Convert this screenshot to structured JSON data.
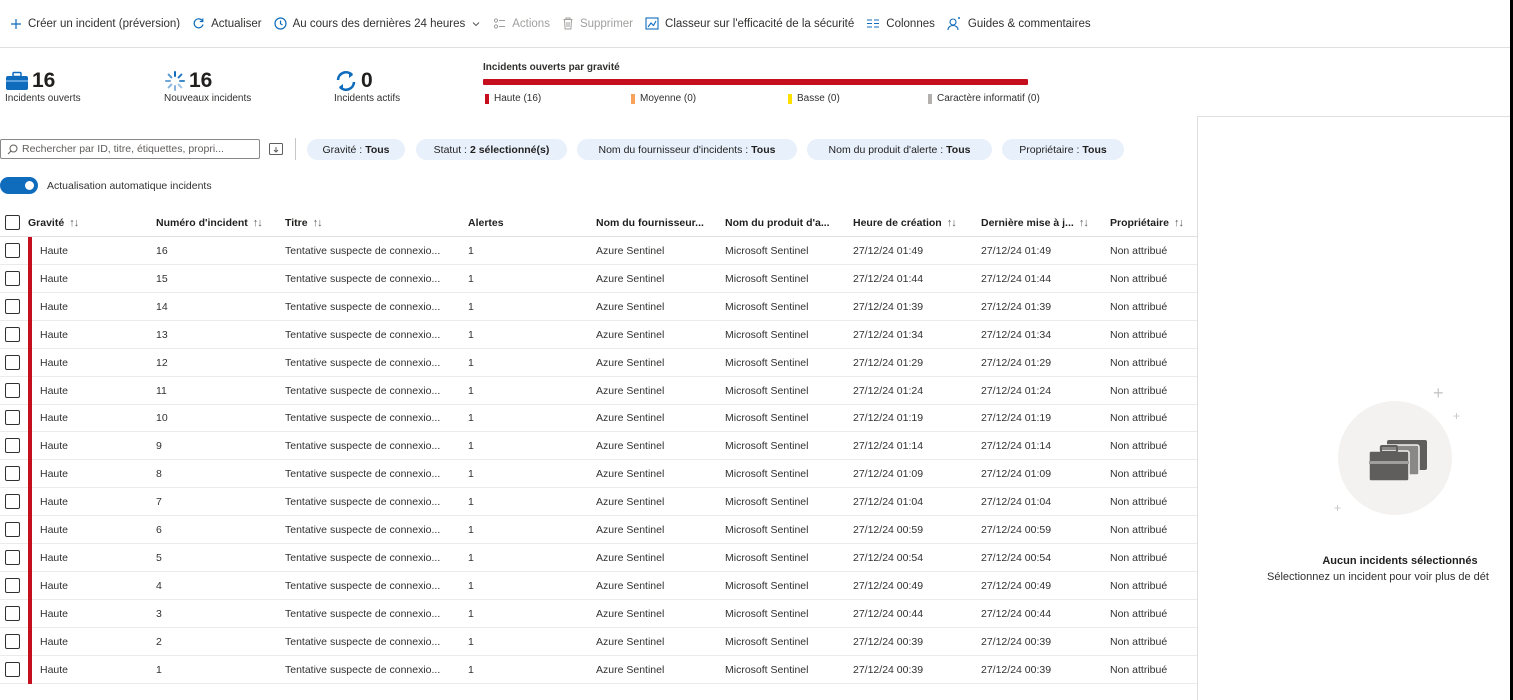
{
  "toolbar": {
    "create": "Créer un incident (préversion)",
    "refresh": "Actualiser",
    "timerange": "Au cours des dernières 24 heures",
    "actions": "Actions",
    "delete": "Supprimer",
    "workbook": "Classeur sur l'efficacité de la sécurité",
    "columns": "Colonnes",
    "guides": "Guides & commentaires"
  },
  "stats": {
    "open": {
      "value": "16",
      "label": "Incidents ouverts"
    },
    "new": {
      "value": "16",
      "label": "Nouveaux incidents"
    },
    "active": {
      "value": "0",
      "label": "Incidents actifs"
    }
  },
  "severity": {
    "title": "Incidents ouverts par gravité",
    "legend": [
      {
        "label": "Haute (16)",
        "color": "#c50f1f"
      },
      {
        "label": "Moyenne (0)",
        "color": "#f7a35c"
      },
      {
        "label": "Basse (0)",
        "color": "#fce100"
      },
      {
        "label": "Caractère informatif (0)",
        "color": "#b3b0ad"
      }
    ]
  },
  "filters": {
    "search_placeholder": "Rechercher par ID, titre, étiquettes, propri...",
    "pills": [
      {
        "name": "Gravité :",
        "value": "Tous"
      },
      {
        "name": "Statut :",
        "value": "2 sélectionné(s)"
      },
      {
        "name": "Nom du fournisseur d'incidents :",
        "value": "Tous"
      },
      {
        "name": "Nom du produit d'alerte :",
        "value": "Tous"
      },
      {
        "name": "Propriétaire :",
        "value": "Tous"
      }
    ],
    "auto_refresh": "Actualisation automatique incidents"
  },
  "table": {
    "columns": [
      "Gravité",
      "Numéro d'incident",
      "Titre",
      "Alertes",
      "Nom du fournisseur...",
      "Nom du produit d'a...",
      "Heure de création",
      "Dernière mise à j...",
      "Propriétaire"
    ],
    "rows": [
      [
        "Haute",
        "16",
        "Tentative suspecte de connexio...",
        "1",
        "Azure Sentinel",
        "Microsoft Sentinel",
        "27/12/24 01:49",
        "27/12/24 01:49",
        "Non attribué"
      ],
      [
        "Haute",
        "15",
        "Tentative suspecte de connexio...",
        "1",
        "Azure Sentinel",
        "Microsoft Sentinel",
        "27/12/24 01:44",
        "27/12/24 01:44",
        "Non attribué"
      ],
      [
        "Haute",
        "14",
        "Tentative suspecte de connexio...",
        "1",
        "Azure Sentinel",
        "Microsoft Sentinel",
        "27/12/24 01:39",
        "27/12/24 01:39",
        "Non attribué"
      ],
      [
        "Haute",
        "13",
        "Tentative suspecte de connexio...",
        "1",
        "Azure Sentinel",
        "Microsoft Sentinel",
        "27/12/24 01:34",
        "27/12/24 01:34",
        "Non attribué"
      ],
      [
        "Haute",
        "12",
        "Tentative suspecte de connexio...",
        "1",
        "Azure Sentinel",
        "Microsoft Sentinel",
        "27/12/24 01:29",
        "27/12/24 01:29",
        "Non attribué"
      ],
      [
        "Haute",
        "11",
        "Tentative suspecte de connexio...",
        "1",
        "Azure Sentinel",
        "Microsoft Sentinel",
        "27/12/24 01:24",
        "27/12/24 01:24",
        "Non attribué"
      ],
      [
        "Haute",
        "10",
        "Tentative suspecte de connexio...",
        "1",
        "Azure Sentinel",
        "Microsoft Sentinel",
        "27/12/24 01:19",
        "27/12/24 01:19",
        "Non attribué"
      ],
      [
        "Haute",
        "9",
        "Tentative suspecte de connexio...",
        "1",
        "Azure Sentinel",
        "Microsoft Sentinel",
        "27/12/24 01:14",
        "27/12/24 01:14",
        "Non attribué"
      ],
      [
        "Haute",
        "8",
        "Tentative suspecte de connexio...",
        "1",
        "Azure Sentinel",
        "Microsoft Sentinel",
        "27/12/24 01:09",
        "27/12/24 01:09",
        "Non attribué"
      ],
      [
        "Haute",
        "7",
        "Tentative suspecte de connexio...",
        "1",
        "Azure Sentinel",
        "Microsoft Sentinel",
        "27/12/24 01:04",
        "27/12/24 01:04",
        "Non attribué"
      ],
      [
        "Haute",
        "6",
        "Tentative suspecte de connexio...",
        "1",
        "Azure Sentinel",
        "Microsoft Sentinel",
        "27/12/24 00:59",
        "27/12/24 00:59",
        "Non attribué"
      ],
      [
        "Haute",
        "5",
        "Tentative suspecte de connexio...",
        "1",
        "Azure Sentinel",
        "Microsoft Sentinel",
        "27/12/24 00:54",
        "27/12/24 00:54",
        "Non attribué"
      ],
      [
        "Haute",
        "4",
        "Tentative suspecte de connexio...",
        "1",
        "Azure Sentinel",
        "Microsoft Sentinel",
        "27/12/24 00:49",
        "27/12/24 00:49",
        "Non attribué"
      ],
      [
        "Haute",
        "3",
        "Tentative suspecte de connexio...",
        "1",
        "Azure Sentinel",
        "Microsoft Sentinel",
        "27/12/24 00:44",
        "27/12/24 00:44",
        "Non attribué"
      ],
      [
        "Haute",
        "2",
        "Tentative suspecte de connexio...",
        "1",
        "Azure Sentinel",
        "Microsoft Sentinel",
        "27/12/24 00:39",
        "27/12/24 00:39",
        "Non attribué"
      ],
      [
        "Haute",
        "1",
        "Tentative suspecte de connexio...",
        "1",
        "Azure Sentinel",
        "Microsoft Sentinel",
        "27/12/24 00:39",
        "27/12/24 00:39",
        "Non attribué"
      ]
    ]
  },
  "detail": {
    "empty_title": "Aucun incidents sélectionnés",
    "empty_subtitle": "Sélectionnez un incident pour voir plus de dét"
  }
}
